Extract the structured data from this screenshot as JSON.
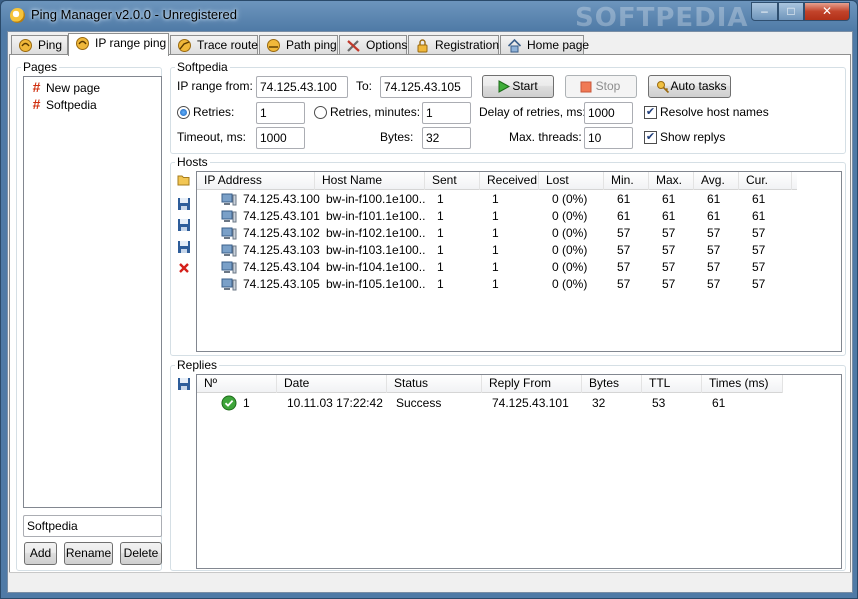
{
  "window": {
    "title": "Ping Manager v2.0.0 - Unregistered",
    "watermark": "SOFTPEDIA"
  },
  "tabs": [
    {
      "label": "Ping"
    },
    {
      "label": "IP range ping"
    },
    {
      "label": "Trace route"
    },
    {
      "label": "Path ping"
    },
    {
      "label": "Options"
    },
    {
      "label": "Registration"
    },
    {
      "label": "Home page"
    }
  ],
  "pages_panel": {
    "title": "Pages",
    "items": [
      {
        "label": "New page"
      },
      {
        "label": "Softpedia"
      }
    ],
    "name_value": "Softpedia",
    "add_label": "Add",
    "rename_label": "Rename",
    "delete_label": "Delete"
  },
  "settings": {
    "title": "Softpedia",
    "ip_from_label": "IP range from:",
    "ip_from_value": "74.125.43.100",
    "to_label": "To:",
    "to_value": "74.125.43.105",
    "start_label": "Start",
    "stop_label": "Stop",
    "auto_tasks_label": "Auto tasks",
    "retries_label": "Retries:",
    "retries_value": "1",
    "retries_minutes_label": "Retries, minutes:",
    "retries_minutes_value": "1",
    "delay_label": "Delay of retries, ms:",
    "delay_value": "1000",
    "resolve_label": "Resolve host names",
    "timeout_label": "Timeout, ms:",
    "timeout_value": "1000",
    "bytes_label": "Bytes:",
    "bytes_value": "32",
    "threads_label": "Max. threads:",
    "threads_value": "10",
    "show_replys_label": "Show replys"
  },
  "hosts": {
    "title": "Hosts",
    "columns": [
      "IP Address",
      "Host Name",
      "Sent",
      "Received",
      "Lost",
      "Min.",
      "Max.",
      "Avg.",
      "Cur."
    ],
    "rows": [
      {
        "ip": "74.125.43.100",
        "host": "bw-in-f100.1e100...",
        "sent": "1",
        "received": "1",
        "lost": "0 (0%)",
        "min": "61",
        "max": "61",
        "avg": "61",
        "cur": "61"
      },
      {
        "ip": "74.125.43.101",
        "host": "bw-in-f101.1e100...",
        "sent": "1",
        "received": "1",
        "lost": "0 (0%)",
        "min": "61",
        "max": "61",
        "avg": "61",
        "cur": "61"
      },
      {
        "ip": "74.125.43.102",
        "host": "bw-in-f102.1e100...",
        "sent": "1",
        "received": "1",
        "lost": "0 (0%)",
        "min": "57",
        "max": "57",
        "avg": "57",
        "cur": "57"
      },
      {
        "ip": "74.125.43.103",
        "host": "bw-in-f103.1e100...",
        "sent": "1",
        "received": "1",
        "lost": "0 (0%)",
        "min": "57",
        "max": "57",
        "avg": "57",
        "cur": "57"
      },
      {
        "ip": "74.125.43.104",
        "host": "bw-in-f104.1e100...",
        "sent": "1",
        "received": "1",
        "lost": "0 (0%)",
        "min": "57",
        "max": "57",
        "avg": "57",
        "cur": "57"
      },
      {
        "ip": "74.125.43.105",
        "host": "bw-in-f105.1e100...",
        "sent": "1",
        "received": "1",
        "lost": "0 (0%)",
        "min": "57",
        "max": "57",
        "avg": "57",
        "cur": "57"
      }
    ]
  },
  "replies": {
    "title": "Replies",
    "columns": [
      "Nº",
      "Date",
      "Status",
      "Reply From",
      "Bytes",
      "TTL",
      "Times (ms)"
    ],
    "rows": [
      {
        "no": "1",
        "date": "10.11.03  17:22:42",
        "status": "Success",
        "from": "74.125.43.101",
        "bytes": "32",
        "ttl": "53",
        "time": "61"
      }
    ]
  }
}
